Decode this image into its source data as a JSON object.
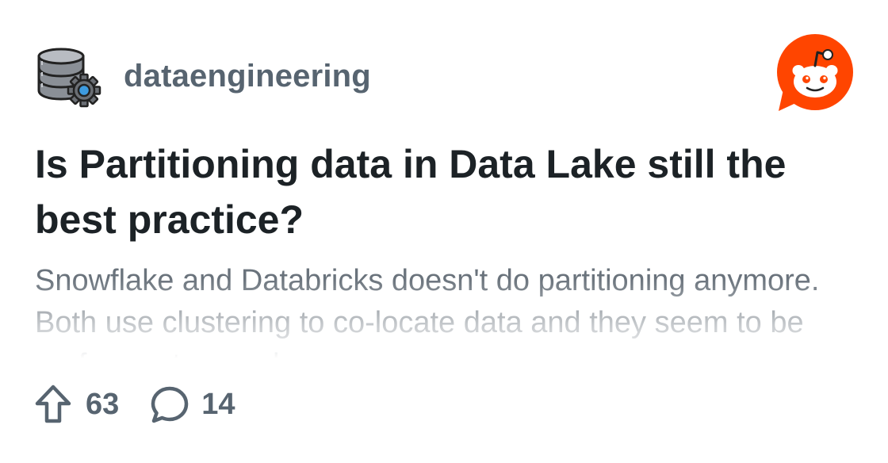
{
  "subreddit": {
    "name": "dataengineering",
    "icon": "database-gear-icon"
  },
  "brand": {
    "logo": "reddit-snoo-icon",
    "accent_color": "#ff4500"
  },
  "post": {
    "title": "Is Partitioning data in Data Lake still the best practice?",
    "body": "Snowflake and Databricks doesn't do partitioning anymore. Both use clustering to co-locate data and they seem to be performant enough."
  },
  "stats": {
    "upvotes": "63",
    "upvote_icon": "upvote-arrow-icon",
    "comments": "14",
    "comment_icon": "comment-bubble-icon"
  },
  "colors": {
    "title": "#1c2226",
    "secondary_text": "#576470",
    "body_text": "#6a737c"
  }
}
